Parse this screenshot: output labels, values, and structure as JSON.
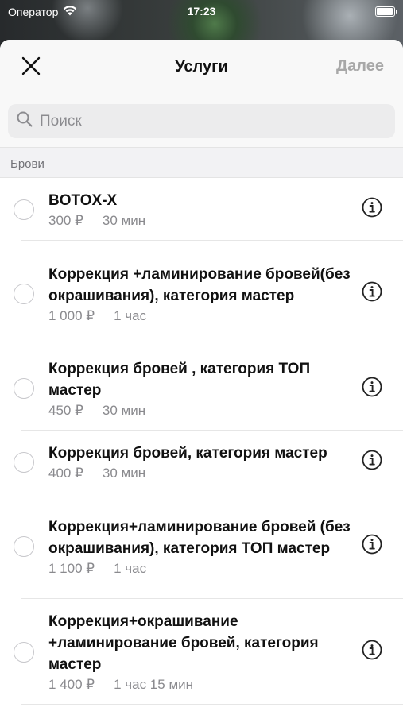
{
  "status_bar": {
    "carrier": "Оператор",
    "time": "17:23",
    "battery_level": 1.0
  },
  "header": {
    "title": "Услуги",
    "next_label": "Далее",
    "close_icon": "close-icon"
  },
  "search": {
    "placeholder": "Поиск",
    "value": ""
  },
  "section": {
    "title": "Брови"
  },
  "services": [
    {
      "name": "BOTOX-X",
      "price": "300 ₽",
      "duration": "30 мин",
      "selected": false
    },
    {
      "name": "Коррекция +ламинирование бровей(без окрашивания), категория мастер",
      "price": "1 000 ₽",
      "duration": "1 час",
      "selected": false
    },
    {
      "name": "Коррекция бровей , категория ТОП мастер",
      "price": "450 ₽",
      "duration": "30 мин",
      "selected": false
    },
    {
      "name": "Коррекция бровей, категория мастер",
      "price": "400 ₽",
      "duration": "30 мин",
      "selected": false
    },
    {
      "name": "Коррекция+ламинирование бровей (без окрашивания), категория ТОП мастер",
      "price": "1 100 ₽",
      "duration": "1 час",
      "selected": false
    },
    {
      "name": "Коррекция+окрашивание +ламинирование  бровей, категория мастер",
      "price": "1 400 ₽",
      "duration": "1 час 15 мин",
      "selected": false
    }
  ]
}
